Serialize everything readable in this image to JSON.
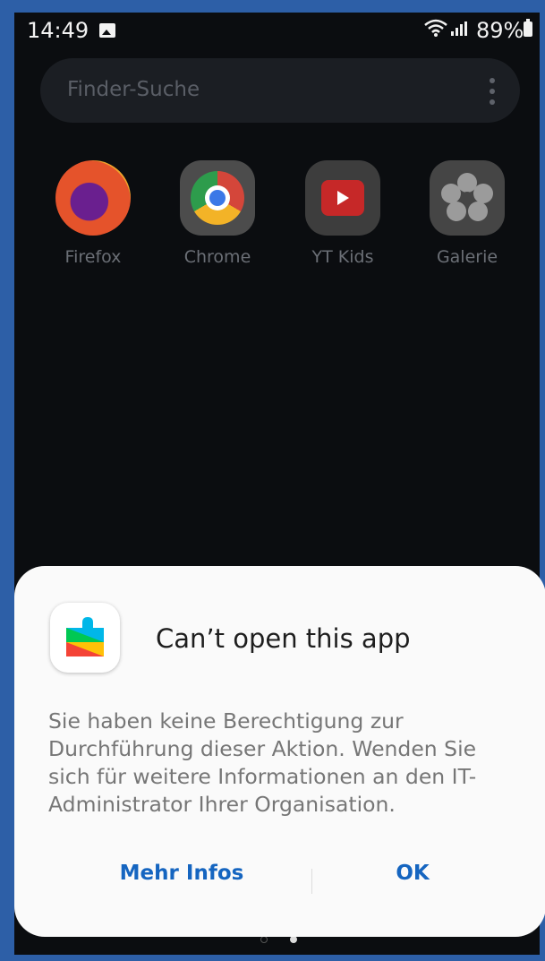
{
  "status_bar": {
    "time": "14:49",
    "battery_percent": "89%",
    "icons": [
      "image-icon",
      "wifi-icon",
      "signal-icon",
      "battery-charging-icon"
    ]
  },
  "search": {
    "placeholder": "Finder-Suche"
  },
  "apps": [
    {
      "label": "Firefox",
      "icon": "firefox-icon"
    },
    {
      "label": "Chrome",
      "icon": "chrome-icon"
    },
    {
      "label": "YT Kids",
      "icon": "youtube-kids-icon"
    },
    {
      "label": "Galerie",
      "icon": "gallery-icon"
    }
  ],
  "dialog": {
    "icon": "google-play-services-icon",
    "title": "Can’t open this app",
    "message": "Sie haben keine Berechtigung zur Durchführung dieser Aktion. Wenden Sie sich für weitere Informationen an den IT-Administrator Ihrer Organisation.",
    "buttons": {
      "more_info": "Mehr Infos",
      "ok": "OK"
    }
  },
  "page_indicator": {
    "count": 2,
    "active": 2
  },
  "colors": {
    "frame": "#2d5fa7",
    "background": "#0b0d10",
    "dialog": "#fafafa",
    "accent": "#1565c0"
  }
}
